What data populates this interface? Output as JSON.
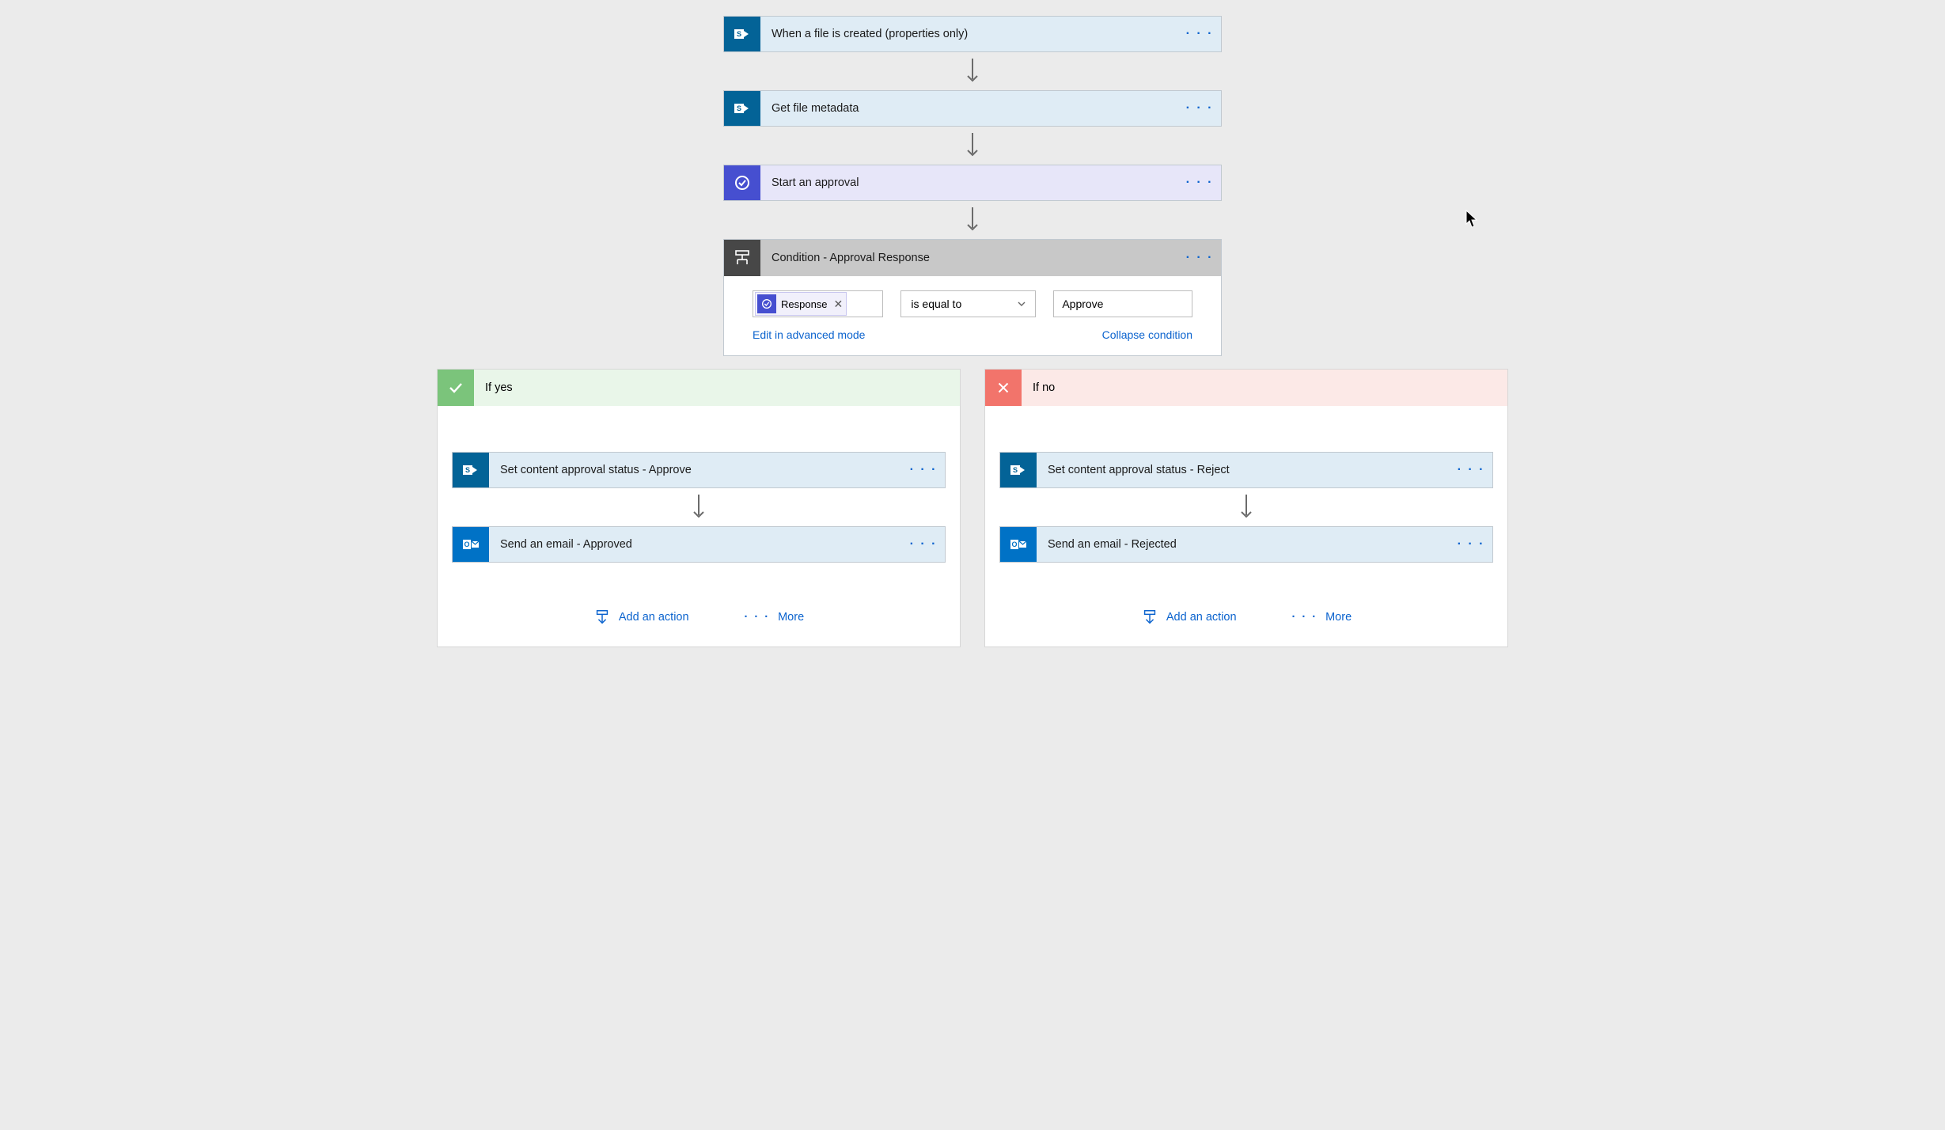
{
  "steps": {
    "trigger": {
      "label": "When a file is created (properties only)"
    },
    "getmeta": {
      "label": "Get file metadata"
    },
    "approval": {
      "label": "Start an approval"
    },
    "condition": {
      "label": "Condition - Approval Response"
    }
  },
  "condition": {
    "chipLabel": "Response",
    "operator": "is equal to",
    "value": "Approve",
    "editLink": "Edit in advanced mode",
    "collapseLink": "Collapse condition"
  },
  "branches": {
    "yes": {
      "title": "If yes",
      "step1": "Set content approval status - Approve",
      "step2": "Send an email - Approved"
    },
    "no": {
      "title": "If no",
      "step1": "Set content approval status - Reject",
      "step2": "Send an email - Rejected"
    }
  },
  "actions": {
    "add": "Add an action",
    "more": "More"
  }
}
